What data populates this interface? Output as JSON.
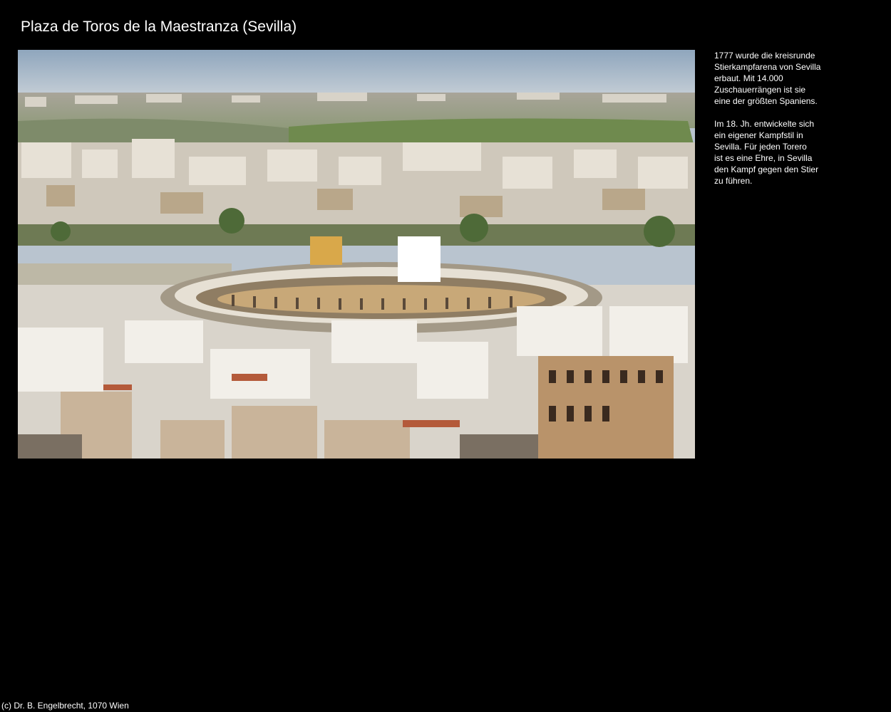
{
  "page": {
    "title": "Plaza de Toros de la Maestranza (Sevilla)",
    "background_color": "#000000",
    "text_color": "#ffffff"
  },
  "photo": {
    "subject": "aerial city view of Sevilla with the Plaza de Toros de la Maestranza bullring"
  },
  "caption": {
    "paragraph_1": "1777 wurde die kreisrunde\nStierkampfarena von Sevilla\nerbaut. Mit 14.000\nZuschauerrängen ist sie\neine der größten Spaniens.",
    "paragraph_2": "Im 18. Jh. entwickelte sich\nein eigener Kampfstil in\nSevilla. Für jeden Torero\nist es eine Ehre, in Sevilla\nden Kampf gegen den Stier\nzu führen."
  },
  "footer": {
    "copyright": "(c) Dr. B. Engelbrecht, 1070 Wien"
  }
}
